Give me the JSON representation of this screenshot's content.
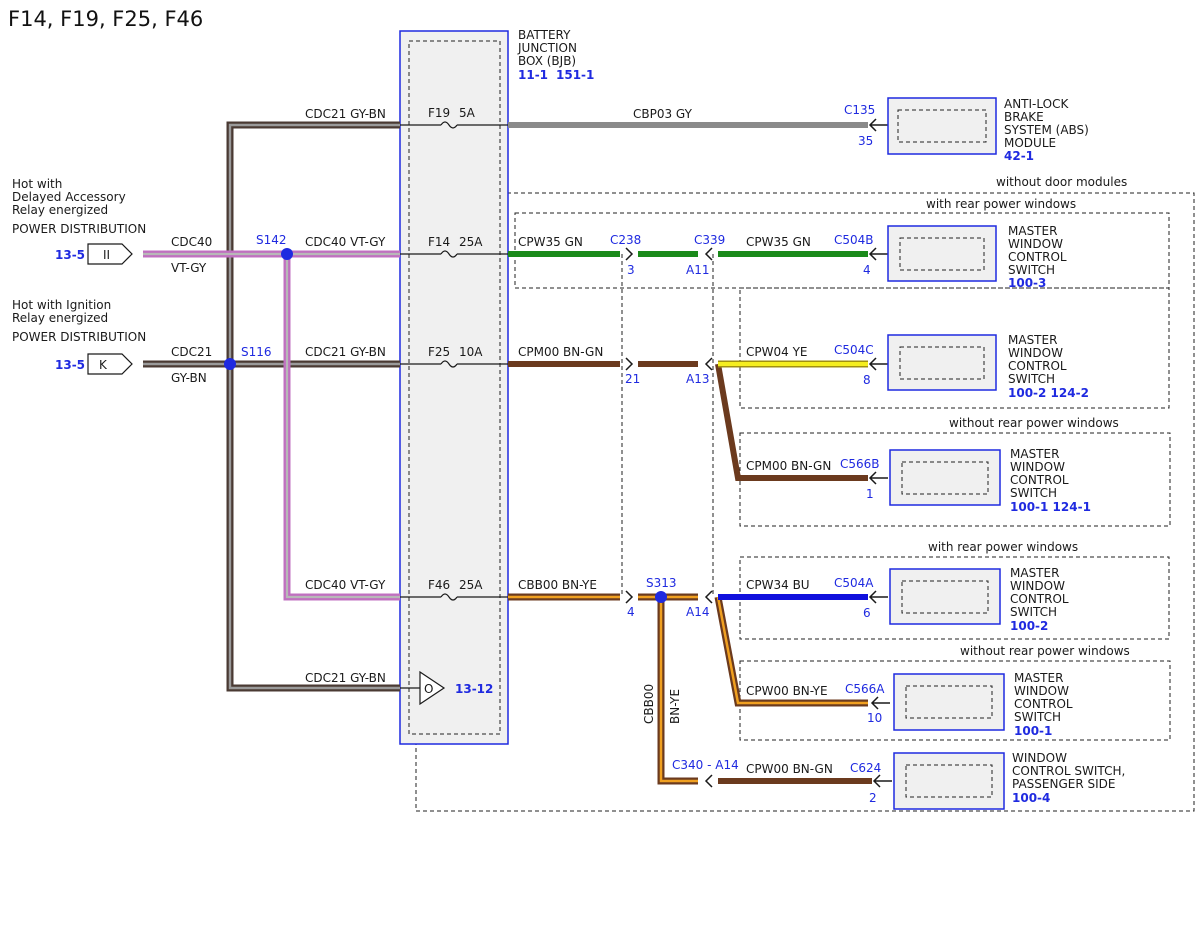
{
  "title": "F14, F19, F25, F46",
  "colors": {
    "gy_bn": "#6e5a52",
    "vt_gy": "#d080d0",
    "gy": "#808080",
    "gn": "#1a8a1a",
    "bn": "#6b3a1e",
    "ye": "#f2ea1a",
    "bu": "#1010dd",
    "bn_ye": "#c07010",
    "connector": "#1f2ae0"
  },
  "bjb": {
    "name_lines": [
      "BATTERY",
      "JUNCTION",
      "BOX (BJB)"
    ],
    "ref1": "11-1",
    "ref2": "151-1",
    "ground_ref": "13-12",
    "ground_symbol": "O"
  },
  "fuses": [
    {
      "label": "F19",
      "amps": "5A"
    },
    {
      "label": "F14",
      "amps": "25A"
    },
    {
      "label": "F25",
      "amps": "10A"
    },
    {
      "label": "F46",
      "amps": "25A"
    }
  ],
  "power": [
    {
      "line1": "Hot with",
      "line2": "Delayed Accessory",
      "line3": "Relay energized",
      "dist": "POWER DISTRIBUTION",
      "ref": "13-5",
      "pin": "II",
      "circuit": "CDC40",
      "color": "VT-GY"
    },
    {
      "line1": "Hot with Ignition",
      "line2": "Relay energized",
      "line3": "",
      "dist": "POWER DISTRIBUTION",
      "ref": "13-5",
      "pin": "K",
      "circuit": "CDC21",
      "color": "GY-BN"
    }
  ],
  "splices": {
    "s142": "S142",
    "s116": "S116",
    "s313": "S313"
  },
  "wires": {
    "w_f19_in": "CDC21  GY-BN",
    "w_f14_in": "CDC40  VT-GY",
    "w_f25_in": "CDC21  GY-BN",
    "w_f46_in": "CDC40  VT-GY",
    "w_gnd_in": "CDC21  GY-BN",
    "w_abs": "CBP03  GY",
    "w_cpw35a": "CPW35  GN",
    "w_cpw35b": "CPW35  GN",
    "w_cpm00": "CPM00  BN-GN",
    "w_cpw04": "CPW04  YE",
    "w_cpm00b": "CPM00  BN-GN",
    "w_cbb00": "CBB00  BN-YE",
    "w_cpw34": "CPW34  BU",
    "w_cpw00": "CPW00  BN-YE",
    "w_cpw00b": "CPW00  BN-GN",
    "w_vert_circ": "CBB00",
    "w_vert_col": "BN-YE"
  },
  "connectors": {
    "c135": "C135",
    "c135_pin": "35",
    "c238": "C238",
    "c238_pin": "3",
    "c339": "C339",
    "c339_pin": "A11",
    "c504b": "C504B",
    "c504b_pin": "4",
    "pin21": "21",
    "pin_a13": "A13",
    "c504c": "C504C",
    "c504c_pin": "8",
    "c566b": "C566B",
    "c566b_pin": "1",
    "pin4": "4",
    "pin_a14": "A14",
    "c504a": "C504A",
    "c504a_pin": "6",
    "c566a": "C566A",
    "c566a_pin": "10",
    "c340": "C340 - A14",
    "c624": "C624",
    "c624_pin": "2"
  },
  "groups": {
    "without_door_modules": "without door modules",
    "with_rear_1": "with rear power windows",
    "without_rear_1": "without rear power windows",
    "with_rear_2": "with rear power windows",
    "without_rear_2": "without rear power windows"
  },
  "modules": [
    {
      "l1": "ANTI-LOCK",
      "l2": "BRAKE",
      "l3": "SYSTEM (ABS)",
      "l4": "MODULE",
      "ref": "42-1"
    },
    {
      "l1": "MASTER",
      "l2": "WINDOW",
      "l3": "CONTROL",
      "l4": "SWITCH",
      "ref": "100-3"
    },
    {
      "l1": "MASTER",
      "l2": "WINDOW",
      "l3": "CONTROL",
      "l4": "SWITCH",
      "ref": "100-2 124-2"
    },
    {
      "l1": "MASTER",
      "l2": "WINDOW",
      "l3": "CONTROL",
      "l4": "SWITCH",
      "ref": "100-1 124-1"
    },
    {
      "l1": "MASTER",
      "l2": "WINDOW",
      "l3": "CONTROL",
      "l4": "SWITCH",
      "ref": "100-2"
    },
    {
      "l1": "MASTER",
      "l2": "WINDOW",
      "l3": "CONTROL",
      "l4": "SWITCH",
      "ref": "100-1"
    },
    {
      "l1": "WINDOW",
      "l2": "CONTROL SWITCH,",
      "l3": "PASSENGER SIDE",
      "l4": "",
      "ref": "100-4"
    }
  ]
}
